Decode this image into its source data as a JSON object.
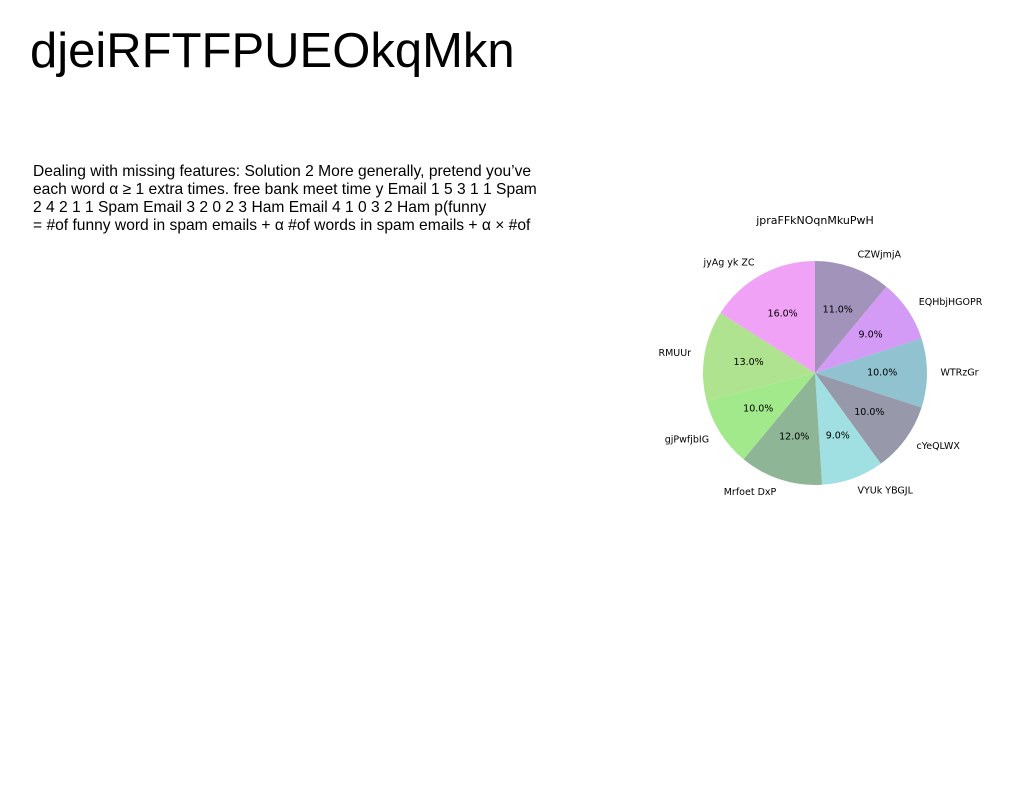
{
  "slide": {
    "title": "djeiRFTFPUEOkqMkn",
    "body_lines": [
      "Dealing with missing features: Solution 2 More generally, pretend you’ve",
      "each word α ≥ 1 extra times. free bank meet time y Email 1 5 3 1 1 Spam",
      "2 4 2 1 1 Spam Email 3 2 0 2 3 Ham Email 4 1 0 3 2 Ham p(funny",
      "= #of funny word in spam emails + α #of words in spam emails + α × #of"
    ]
  },
  "chart_data": {
    "type": "pie",
    "title": "jpraFFkNOqnMkuPwH",
    "start_angle_deg": 90,
    "direction": "clockwise",
    "slices": [
      {
        "label": "CZWjmjA",
        "value": 11.0,
        "pct_label": "11.0%",
        "color": "#a293bb"
      },
      {
        "label": "EQHbjHGOPR",
        "value": 9.0,
        "pct_label": "9.0%",
        "color": "#d39bf6"
      },
      {
        "label": "WTRzGr",
        "value": 10.0,
        "pct_label": "10.0%",
        "color": "#90c2cf"
      },
      {
        "label": "cYeQLWX",
        "value": 10.0,
        "pct_label": "10.0%",
        "color": "#9798aa"
      },
      {
        "label": "VYUk YBGJL",
        "value": 9.0,
        "pct_label": "9.0%",
        "color": "#a0dfe2"
      },
      {
        "label": "Mrfoet DxP",
        "value": 12.0,
        "pct_label": "12.0%",
        "color": "#8db596"
      },
      {
        "label": "gjPwfjbIG",
        "value": 10.0,
        "pct_label": "10.0%",
        "color": "#a1e98a"
      },
      {
        "label": "RMUUr",
        "value": 13.0,
        "pct_label": "13.0%",
        "color": "#afe38f"
      },
      {
        "label": "jyAg yk ZC",
        "value": 16.0,
        "pct_label": "16.0%",
        "color": "#f0a3f6"
      }
    ]
  }
}
